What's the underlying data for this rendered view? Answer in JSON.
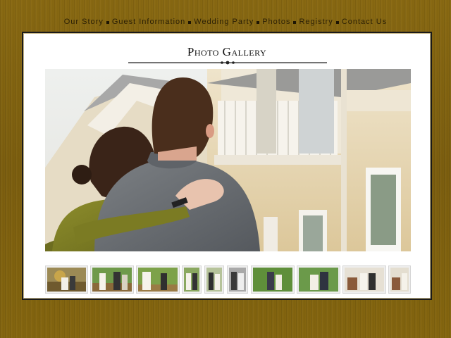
{
  "nav": {
    "items": [
      {
        "label": "Our Story"
      },
      {
        "label": "Guest Information"
      },
      {
        "label": "Wedding Party"
      },
      {
        "label": "Photos"
      },
      {
        "label": "Registry"
      },
      {
        "label": "Contact Us"
      }
    ]
  },
  "gallery": {
    "title": "Photo Gallery",
    "main_photo": "couple-hugging-in-front-of-house-photo",
    "thumbnails": [
      {
        "name": "thumbnail-1",
        "scene": "garden"
      },
      {
        "name": "thumbnail-2",
        "scene": "garden"
      },
      {
        "name": "thumbnail-3",
        "scene": "garden"
      },
      {
        "name": "thumbnail-4",
        "scene": "garden-narrow"
      },
      {
        "name": "thumbnail-5",
        "scene": "garden-narrow"
      },
      {
        "name": "thumbnail-6",
        "scene": "grey-narrow"
      },
      {
        "name": "thumbnail-7",
        "scene": "garden"
      },
      {
        "name": "thumbnail-8",
        "scene": "garden"
      },
      {
        "name": "thumbnail-9",
        "scene": "indoor"
      },
      {
        "name": "thumbnail-10",
        "scene": "indoor-partial"
      }
    ]
  },
  "colors": {
    "background": "#86670f",
    "panel": "#ffffff",
    "nav_text": "#2a1f05",
    "title_text": "#111111"
  }
}
